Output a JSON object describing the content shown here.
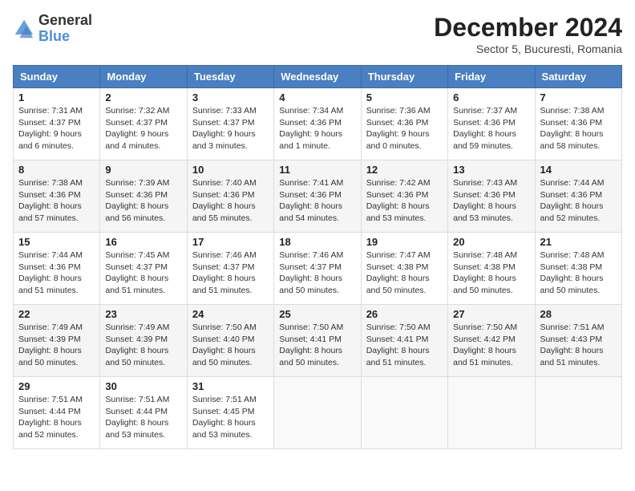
{
  "logo": {
    "general": "General",
    "blue": "Blue"
  },
  "title": "December 2024",
  "subtitle": "Sector 5, Bucuresti, Romania",
  "days_header": [
    "Sunday",
    "Monday",
    "Tuesday",
    "Wednesday",
    "Thursday",
    "Friday",
    "Saturday"
  ],
  "weeks": [
    [
      {
        "day": "1",
        "sunrise": "7:31 AM",
        "sunset": "4:37 PM",
        "daylight": "9 hours and 6 minutes."
      },
      {
        "day": "2",
        "sunrise": "7:32 AM",
        "sunset": "4:37 PM",
        "daylight": "9 hours and 4 minutes."
      },
      {
        "day": "3",
        "sunrise": "7:33 AM",
        "sunset": "4:37 PM",
        "daylight": "9 hours and 3 minutes."
      },
      {
        "day": "4",
        "sunrise": "7:34 AM",
        "sunset": "4:36 PM",
        "daylight": "9 hours and 1 minute."
      },
      {
        "day": "5",
        "sunrise": "7:36 AM",
        "sunset": "4:36 PM",
        "daylight": "9 hours and 0 minutes."
      },
      {
        "day": "6",
        "sunrise": "7:37 AM",
        "sunset": "4:36 PM",
        "daylight": "8 hours and 59 minutes."
      },
      {
        "day": "7",
        "sunrise": "7:38 AM",
        "sunset": "4:36 PM",
        "daylight": "8 hours and 58 minutes."
      }
    ],
    [
      {
        "day": "8",
        "sunrise": "7:38 AM",
        "sunset": "4:36 PM",
        "daylight": "8 hours and 57 minutes."
      },
      {
        "day": "9",
        "sunrise": "7:39 AM",
        "sunset": "4:36 PM",
        "daylight": "8 hours and 56 minutes."
      },
      {
        "day": "10",
        "sunrise": "7:40 AM",
        "sunset": "4:36 PM",
        "daylight": "8 hours and 55 minutes."
      },
      {
        "day": "11",
        "sunrise": "7:41 AM",
        "sunset": "4:36 PM",
        "daylight": "8 hours and 54 minutes."
      },
      {
        "day": "12",
        "sunrise": "7:42 AM",
        "sunset": "4:36 PM",
        "daylight": "8 hours and 53 minutes."
      },
      {
        "day": "13",
        "sunrise": "7:43 AM",
        "sunset": "4:36 PM",
        "daylight": "8 hours and 53 minutes."
      },
      {
        "day": "14",
        "sunrise": "7:44 AM",
        "sunset": "4:36 PM",
        "daylight": "8 hours and 52 minutes."
      }
    ],
    [
      {
        "day": "15",
        "sunrise": "7:44 AM",
        "sunset": "4:36 PM",
        "daylight": "8 hours and 51 minutes."
      },
      {
        "day": "16",
        "sunrise": "7:45 AM",
        "sunset": "4:37 PM",
        "daylight": "8 hours and 51 minutes."
      },
      {
        "day": "17",
        "sunrise": "7:46 AM",
        "sunset": "4:37 PM",
        "daylight": "8 hours and 51 minutes."
      },
      {
        "day": "18",
        "sunrise": "7:46 AM",
        "sunset": "4:37 PM",
        "daylight": "8 hours and 50 minutes."
      },
      {
        "day": "19",
        "sunrise": "7:47 AM",
        "sunset": "4:38 PM",
        "daylight": "8 hours and 50 minutes."
      },
      {
        "day": "20",
        "sunrise": "7:48 AM",
        "sunset": "4:38 PM",
        "daylight": "8 hours and 50 minutes."
      },
      {
        "day": "21",
        "sunrise": "7:48 AM",
        "sunset": "4:38 PM",
        "daylight": "8 hours and 50 minutes."
      }
    ],
    [
      {
        "day": "22",
        "sunrise": "7:49 AM",
        "sunset": "4:39 PM",
        "daylight": "8 hours and 50 minutes."
      },
      {
        "day": "23",
        "sunrise": "7:49 AM",
        "sunset": "4:39 PM",
        "daylight": "8 hours and 50 minutes."
      },
      {
        "day": "24",
        "sunrise": "7:50 AM",
        "sunset": "4:40 PM",
        "daylight": "8 hours and 50 minutes."
      },
      {
        "day": "25",
        "sunrise": "7:50 AM",
        "sunset": "4:41 PM",
        "daylight": "8 hours and 50 minutes."
      },
      {
        "day": "26",
        "sunrise": "7:50 AM",
        "sunset": "4:41 PM",
        "daylight": "8 hours and 51 minutes."
      },
      {
        "day": "27",
        "sunrise": "7:50 AM",
        "sunset": "4:42 PM",
        "daylight": "8 hours and 51 minutes."
      },
      {
        "day": "28",
        "sunrise": "7:51 AM",
        "sunset": "4:43 PM",
        "daylight": "8 hours and 51 minutes."
      }
    ],
    [
      {
        "day": "29",
        "sunrise": "7:51 AM",
        "sunset": "4:44 PM",
        "daylight": "8 hours and 52 minutes."
      },
      {
        "day": "30",
        "sunrise": "7:51 AM",
        "sunset": "4:44 PM",
        "daylight": "8 hours and 53 minutes."
      },
      {
        "day": "31",
        "sunrise": "7:51 AM",
        "sunset": "4:45 PM",
        "daylight": "8 hours and 53 minutes."
      },
      null,
      null,
      null,
      null
    ]
  ]
}
